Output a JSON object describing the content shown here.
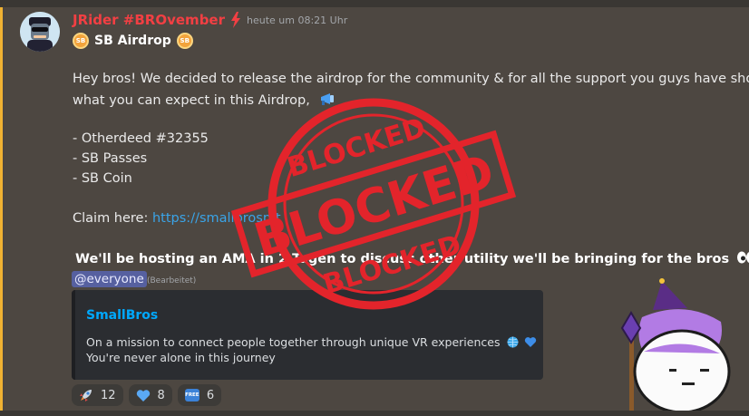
{
  "message": {
    "author": "JRider #BROvember",
    "timestamp": "heute um 08:21 Uhr",
    "title": "SB Airdrop",
    "sb_badge": "SB",
    "intro_line1": "Hey bros! We decided to release the airdrop for the community & for all the support you guys have shown.",
    "intro_line2": "what you can expect in this Airdrop,",
    "items": [
      "- Otherdeed #32355",
      "- SB Passes",
      "- SB Coin"
    ],
    "claim_label": "Claim here:",
    "claim_link": "https://smallbrosnft",
    "ama_line": "We'll be hosting an AMA  in 2 Tagen  to discuss other utility we'll be bringing for the bros",
    "mention": "@everyone",
    "edited": "(Bearbeitet)"
  },
  "embed": {
    "title": "SmallBros",
    "description_line1": "On a mission to connect people together through unique VR experiences",
    "description_line2": "You're never alone in this journey"
  },
  "reactions": [
    {
      "icon": "rocket-icon",
      "count": "12"
    },
    {
      "icon": "blue-heart-icon",
      "count": "8"
    },
    {
      "icon": "free-icon",
      "count": "6",
      "label": "FREE"
    }
  ],
  "stamp": {
    "text_top": "BLOCKED",
    "text_main": "BLOCKED",
    "text_bottom": "BLOCKED",
    "color": "#e3242b"
  },
  "colors": {
    "username": "#f23f43",
    "link": "#3aa4e8",
    "accent_bar": "#f0b232",
    "mention_bg": "#5660a0",
    "embed_title": "#00a8fc"
  }
}
